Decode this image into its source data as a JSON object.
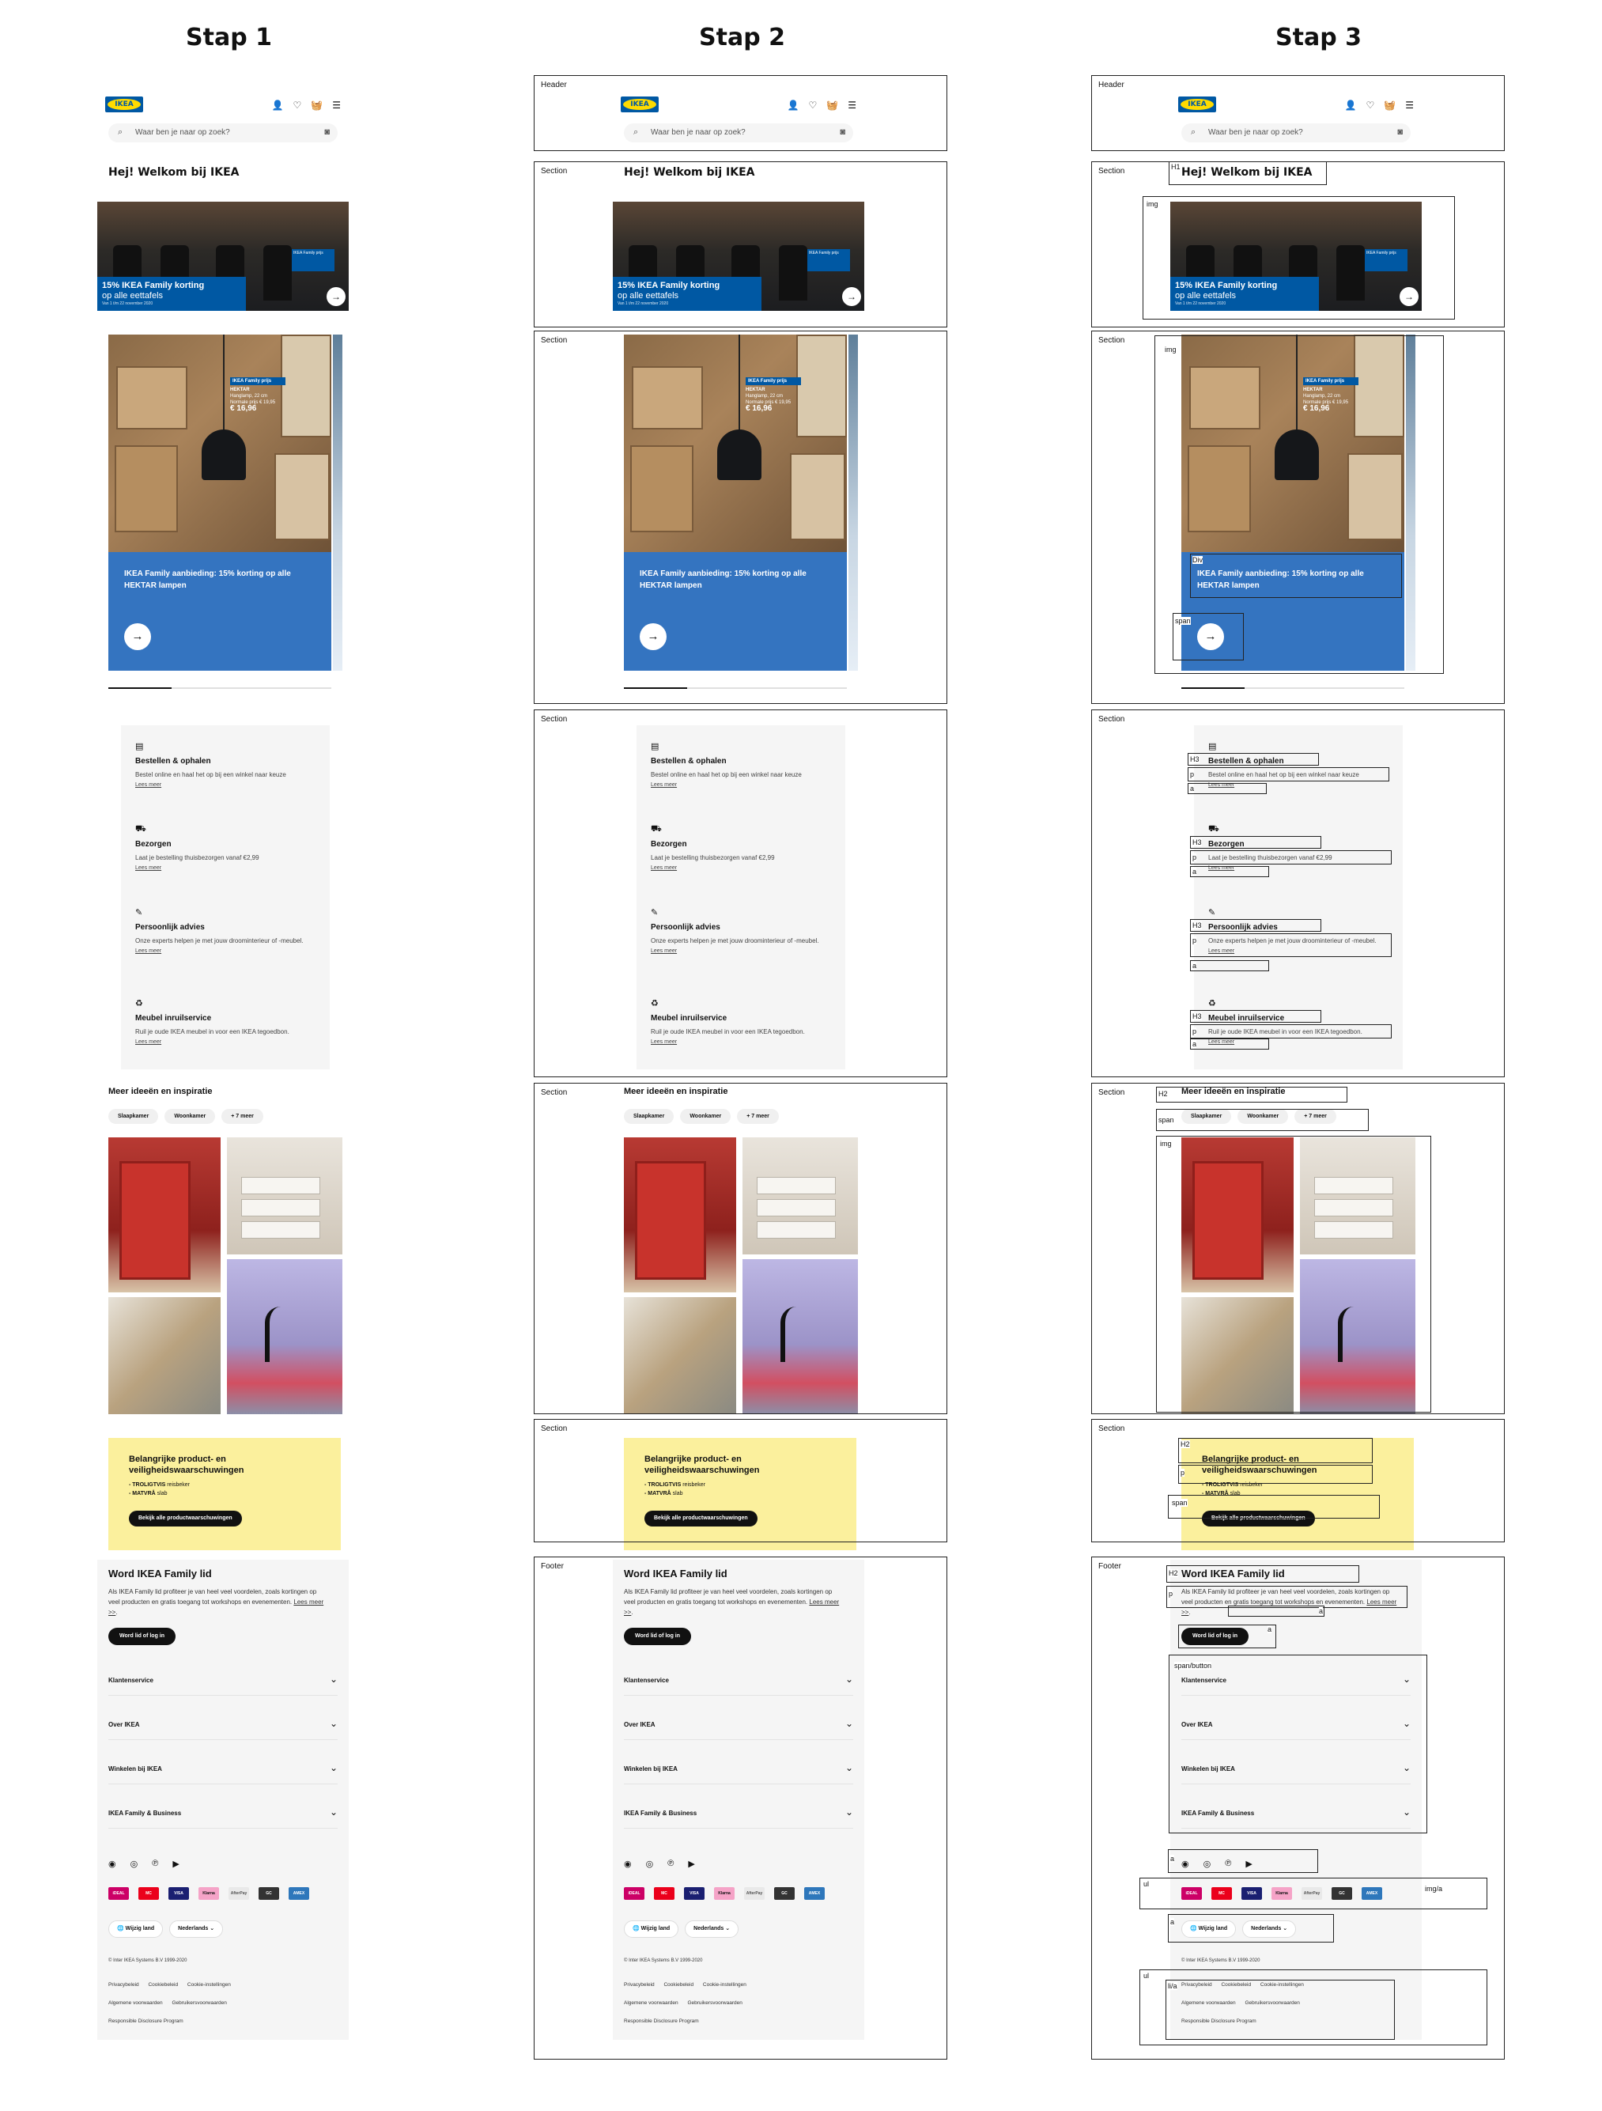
{
  "columns": [
    "Stap 1",
    "Stap 2",
    "Stap 3"
  ],
  "mobile": {
    "search_placeholder": "Waar ben je naar op zoek?",
    "welcome": "Hej! Welkom bij IKEA",
    "logo": "IKEA",
    "hero": {
      "line1": "15% IKEA Family korting",
      "line2": "op alle eettafels",
      "fine": "Van 1 t/m 22 november 2020",
      "small_tag": "IKEA Family prijs"
    },
    "product_card": {
      "badge": "IKEA Family prijs",
      "name": "HEKTAR",
      "desc": "Hanglamp, 22 cm",
      "old_price": "Normale prijs € 19,95",
      "price": "€ 16,96",
      "text": "IKEA Family aanbieding: 15% korting op alle HEKTAR lampen"
    },
    "services": [
      {
        "icon": "cart-icon",
        "title": "Bestellen & ophalen",
        "desc": "Bestel online en haal het op bij een winkel naar keuze",
        "link": "Lees meer"
      },
      {
        "icon": "truck-icon",
        "title": "Bezorgen",
        "desc": "Laat je bestelling thuisbezorgen vanaf €2,99",
        "link": "Lees meer"
      },
      {
        "icon": "edit-icon",
        "title": "Persoonlijk advies",
        "desc": "Onze experts helpen je met jouw droominterieur of -meubel.",
        "link": "Lees meer"
      },
      {
        "icon": "recycle-icon",
        "title": "Meubel inruilservice",
        "desc": "Ruil je oude IKEA meubel in voor een IKEA tegoedbon.",
        "link": "Lees meer"
      }
    ],
    "inspiration": {
      "title": "Meer ideeën en inspiratie",
      "chips": [
        "Slaapkamer",
        "Woonkamer",
        "+ 7 meer"
      ]
    },
    "warning": {
      "title": "Belangrijke product- en veiligheidswaarschuwingen",
      "item1_bold": "- TROLIGTVIS",
      "item1_rest": " reisbeker",
      "item2_bold": "- MATVRÅ",
      "item2_rest": " slab",
      "button": "Bekijk alle productwaarschuwingen"
    },
    "footer": {
      "title": "Word IKEA Family lid",
      "text": "Als IKEA Family lid profiteer je van heel veel voordelen, zoals kortingen op veel producten en gratis toegang tot workshops en evenementen.",
      "more": "Lees meer >>",
      "button": "Word lid of log in",
      "accordions": [
        "Klantenservice",
        "Over IKEA",
        "Winkelen bij IKEA",
        "IKEA Family & Business"
      ],
      "payments": [
        "iDEAL",
        "MC",
        "VISA",
        "Klarna",
        "AfterPay",
        "GC",
        "AMEX"
      ],
      "country": "Wijzig land",
      "language": "Nederlands",
      "copyright": "© Inter IKEA Systems B.V 1999-2020",
      "links": [
        "Privacybeleid",
        "Cookiebeleid",
        "Cookie-instellingen",
        "Algemene voorwaarden",
        "Gebruikersvoorwaarden",
        "Responsible Disclosure Program"
      ]
    }
  },
  "stap2_labels": {
    "header": "Header",
    "section": "Section",
    "footer": "Footer"
  },
  "stap3_labels": {
    "header": "Header",
    "section": "Section",
    "footer": "Footer",
    "h1": "H1",
    "img": "img",
    "div": "Div",
    "span": "span",
    "h3": "H3",
    "p": "p",
    "a": "a",
    "h2": "H2",
    "span_button": "span/button",
    "ul": "ul",
    "img_a": "img/a",
    "li_a": "li/a"
  }
}
